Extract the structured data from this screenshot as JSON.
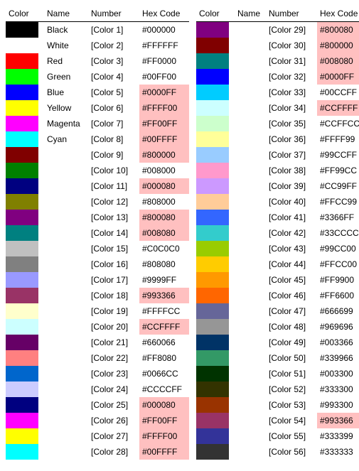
{
  "headers": {
    "color": "Color",
    "name": "Name",
    "number": "Number",
    "hex": "Hex Code"
  },
  "left": [
    {
      "swatch": "#000000",
      "name": "Black",
      "number": "[Color 1]",
      "hex": "#000000",
      "hl": false
    },
    {
      "swatch": "#FFFFFF",
      "name": "White",
      "number": "[Color 2]",
      "hex": "#FFFFFF",
      "hl": false
    },
    {
      "swatch": "#FF0000",
      "name": "Red",
      "number": "[Color 3]",
      "hex": "#FF0000",
      "hl": false
    },
    {
      "swatch": "#00FF00",
      "name": "Green",
      "number": "[Color 4]",
      "hex": "#00FF00",
      "hl": false
    },
    {
      "swatch": "#0000FF",
      "name": "Blue",
      "number": "[Color 5]",
      "hex": "#0000FF",
      "hl": true
    },
    {
      "swatch": "#FFFF00",
      "name": "Yellow",
      "number": "[Color 6]",
      "hex": "#FFFF00",
      "hl": true
    },
    {
      "swatch": "#FF00FF",
      "name": "Magenta",
      "number": "[Color 7]",
      "hex": "#FF00FF",
      "hl": true
    },
    {
      "swatch": "#00FFFF",
      "name": "Cyan",
      "number": "[Color 8]",
      "hex": "#00FFFF",
      "hl": true
    },
    {
      "swatch": "#800000",
      "name": "",
      "number": "[Color 9]",
      "hex": "#800000",
      "hl": true
    },
    {
      "swatch": "#008000",
      "name": "",
      "number": "[Color 10]",
      "hex": "#008000",
      "hl": false
    },
    {
      "swatch": "#000080",
      "name": "",
      "number": "[Color 11]",
      "hex": "#000080",
      "hl": true
    },
    {
      "swatch": "#808000",
      "name": "",
      "number": "[Color 12]",
      "hex": "#808000",
      "hl": false
    },
    {
      "swatch": "#800080",
      "name": "",
      "number": "[Color 13]",
      "hex": "#800080",
      "hl": true
    },
    {
      "swatch": "#008080",
      "name": "",
      "number": "[Color 14]",
      "hex": "#008080",
      "hl": true
    },
    {
      "swatch": "#C0C0C0",
      "name": "",
      "number": "[Color 15]",
      "hex": "#C0C0C0",
      "hl": false
    },
    {
      "swatch": "#808080",
      "name": "",
      "number": "[Color 16]",
      "hex": "#808080",
      "hl": false
    },
    {
      "swatch": "#9999FF",
      "name": "",
      "number": "[Color 17]",
      "hex": "#9999FF",
      "hl": false
    },
    {
      "swatch": "#993366",
      "name": "",
      "number": "[Color 18]",
      "hex": "#993366",
      "hl": true
    },
    {
      "swatch": "#FFFFCC",
      "name": "",
      "number": "[Color 19]",
      "hex": "#FFFFCC",
      "hl": false
    },
    {
      "swatch": "#CCFFFF",
      "name": "",
      "number": "[Color 20]",
      "hex": "#CCFFFF",
      "hl": true
    },
    {
      "swatch": "#660066",
      "name": "",
      "number": "[Color 21]",
      "hex": "#660066",
      "hl": false
    },
    {
      "swatch": "#FF8080",
      "name": "",
      "number": "[Color 22]",
      "hex": "#FF8080",
      "hl": false
    },
    {
      "swatch": "#0066CC",
      "name": "",
      "number": "[Color 23]",
      "hex": "#0066CC",
      "hl": false
    },
    {
      "swatch": "#CCCCFF",
      "name": "",
      "number": "[Color 24]",
      "hex": "#CCCCFF",
      "hl": false
    },
    {
      "swatch": "#000080",
      "name": "",
      "number": "[Color 25]",
      "hex": "#000080",
      "hl": true
    },
    {
      "swatch": "#FF00FF",
      "name": "",
      "number": "[Color 26]",
      "hex": "#FF00FF",
      "hl": true
    },
    {
      "swatch": "#FFFF00",
      "name": "",
      "number": "[Color 27]",
      "hex": "#FFFF00",
      "hl": true
    },
    {
      "swatch": "#00FFFF",
      "name": "",
      "number": "[Color 28]",
      "hex": "#00FFFF",
      "hl": true
    }
  ],
  "right": [
    {
      "swatch": "#800080",
      "name": "",
      "number": "[Color 29]",
      "hex": "#800080",
      "hl": true
    },
    {
      "swatch": "#800000",
      "name": "",
      "number": "[Color 30]",
      "hex": "#800000",
      "hl": true
    },
    {
      "swatch": "#008080",
      "name": "",
      "number": "[Color 31]",
      "hex": "#008080",
      "hl": true
    },
    {
      "swatch": "#0000FF",
      "name": "",
      "number": "[Color 32]",
      "hex": "#0000FF",
      "hl": true
    },
    {
      "swatch": "#00CCFF",
      "name": "",
      "number": "[Color 33]",
      "hex": "#00CCFF",
      "hl": false
    },
    {
      "swatch": "#CCFFFF",
      "name": "",
      "number": "[Color 34]",
      "hex": "#CCFFFF",
      "hl": true
    },
    {
      "swatch": "#CCFFCC",
      "name": "",
      "number": "[Color 35]",
      "hex": "#CCFFCC",
      "hl": false
    },
    {
      "swatch": "#FFFF99",
      "name": "",
      "number": "[Color 36]",
      "hex": "#FFFF99",
      "hl": false
    },
    {
      "swatch": "#99CCFF",
      "name": "",
      "number": "[Color 37]",
      "hex": "#99CCFF",
      "hl": false
    },
    {
      "swatch": "#FF99CC",
      "name": "",
      "number": "[Color 38]",
      "hex": "#FF99CC",
      "hl": false
    },
    {
      "swatch": "#CC99FF",
      "name": "",
      "number": "[Color 39]",
      "hex": "#CC99FF",
      "hl": false
    },
    {
      "swatch": "#FFCC99",
      "name": "",
      "number": "[Color 40]",
      "hex": "#FFCC99",
      "hl": false
    },
    {
      "swatch": "#3366FF",
      "name": "",
      "number": "[Color 41]",
      "hex": "#3366FF",
      "hl": false
    },
    {
      "swatch": "#33CCCC",
      "name": "",
      "number": "[Color 42]",
      "hex": "#33CCCC",
      "hl": false
    },
    {
      "swatch": "#99CC00",
      "name": "",
      "number": "[Color 43]",
      "hex": "#99CC00",
      "hl": false
    },
    {
      "swatch": "#FFCC00",
      "name": "",
      "number": "[Color 44]",
      "hex": "#FFCC00",
      "hl": false
    },
    {
      "swatch": "#FF9900",
      "name": "",
      "number": "[Color 45]",
      "hex": "#FF9900",
      "hl": false
    },
    {
      "swatch": "#FF6600",
      "name": "",
      "number": "[Color 46]",
      "hex": "#FF6600",
      "hl": false
    },
    {
      "swatch": "#666699",
      "name": "",
      "number": "[Color 47]",
      "hex": "#666699",
      "hl": false
    },
    {
      "swatch": "#969696",
      "name": "",
      "number": "[Color 48]",
      "hex": "#969696",
      "hl": false
    },
    {
      "swatch": "#003366",
      "name": "",
      "number": "[Color 49]",
      "hex": "#003366",
      "hl": false
    },
    {
      "swatch": "#339966",
      "name": "",
      "number": "[Color 50]",
      "hex": "#339966",
      "hl": false
    },
    {
      "swatch": "#003300",
      "name": "",
      "number": "[Color 51]",
      "hex": "#003300",
      "hl": false
    },
    {
      "swatch": "#333300",
      "name": "",
      "number": "[Color 52]",
      "hex": "#333300",
      "hl": false
    },
    {
      "swatch": "#993300",
      "name": "",
      "number": "[Color 53]",
      "hex": "#993300",
      "hl": false
    },
    {
      "swatch": "#993366",
      "name": "",
      "number": "[Color 54]",
      "hex": "#993366",
      "hl": true
    },
    {
      "swatch": "#333399",
      "name": "",
      "number": "[Color 55]",
      "hex": "#333399",
      "hl": false
    },
    {
      "swatch": "#333333",
      "name": "",
      "number": "[Color 56]",
      "hex": "#333333",
      "hl": false
    }
  ]
}
